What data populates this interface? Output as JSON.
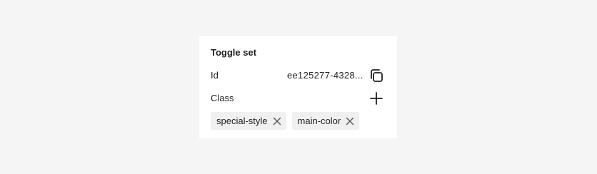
{
  "panel": {
    "title": "Toggle set",
    "id_label": "Id",
    "id_value": "ee125277-4328...",
    "class_label": "Class",
    "copy_icon": "copy-icon",
    "add_icon": "plus-icon",
    "tags": [
      {
        "label": "special-style",
        "remove_icon": "close-icon"
      },
      {
        "label": "main-color",
        "remove_icon": "close-icon"
      }
    ]
  }
}
